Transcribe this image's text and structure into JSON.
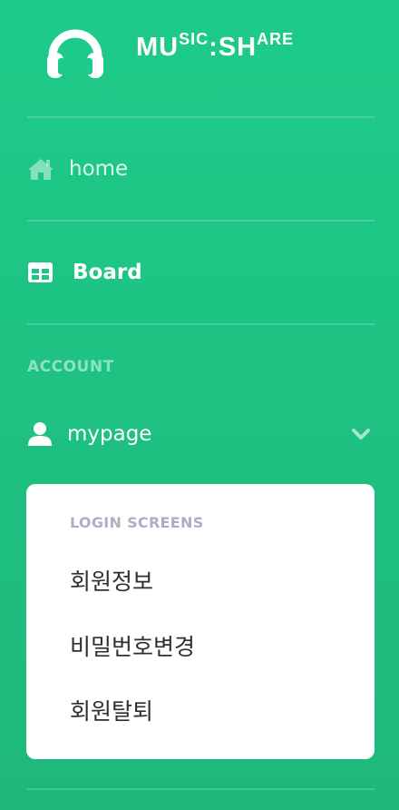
{
  "brand": {
    "name_part1": "MU",
    "name_sup1": "SIC",
    "name_part2": ":SH",
    "name_sup2": "ARE",
    "icon": "headphones-icon"
  },
  "nav": {
    "home": {
      "label": "home",
      "icon": "home-icon"
    },
    "board": {
      "label": "Board",
      "icon": "table-icon"
    }
  },
  "account": {
    "heading": "ACCOUNT",
    "mypage": {
      "label": "mypage",
      "icon": "user-icon",
      "toggle_icon": "chevron-down-icon"
    }
  },
  "submenu": {
    "heading": "LOGIN SCREENS",
    "items": [
      {
        "label": "회원정보"
      },
      {
        "label": "비밀번호변경"
      },
      {
        "label": "회원탈퇴"
      }
    ]
  },
  "colors": {
    "sidebar_top": "#1ecb8a",
    "sidebar_bottom": "#1eb87a",
    "submenu_bg": "#ffffff",
    "submenu_heading": "#aab0c2",
    "submenu_text": "#2e2e33"
  }
}
